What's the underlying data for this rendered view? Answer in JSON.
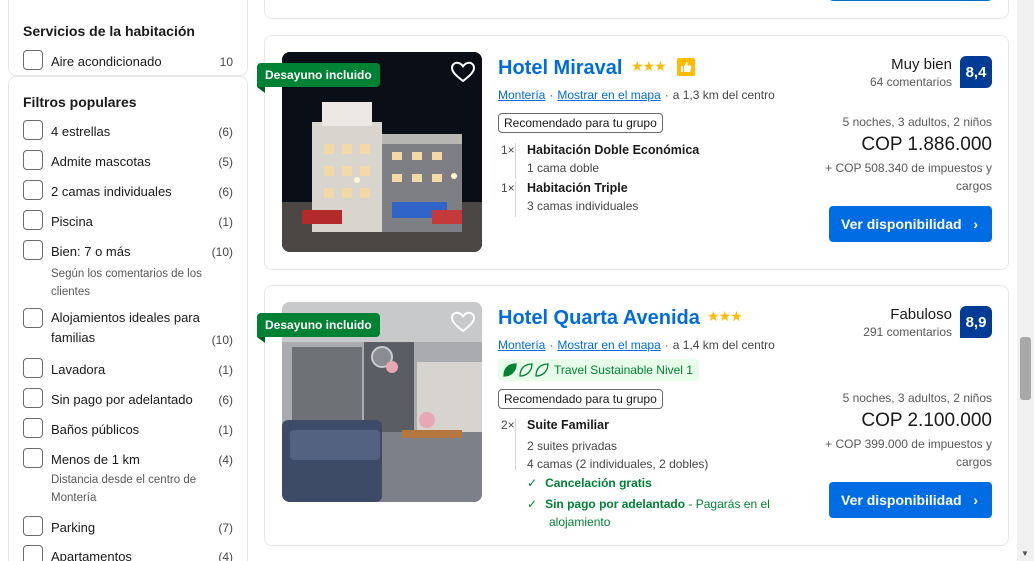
{
  "sidebar": {
    "room_services": {
      "heading": "Servicios de la habitación",
      "items": [
        {
          "label": "Aire acondicionado",
          "count": "10"
        }
      ]
    },
    "popular_filters": {
      "heading": "Filtros populares",
      "items": [
        {
          "label": "4 estrellas",
          "count": "(6)"
        },
        {
          "label": "Admite mascotas",
          "count": "(5)"
        },
        {
          "label": "2 camas individuales",
          "count": "(6)"
        },
        {
          "label": "Piscina",
          "count": "(1)"
        },
        {
          "label": "Bien: 7 o más",
          "count": "(10)",
          "sub": "Según los comentarios de los clientes"
        },
        {
          "label": "Alojamientos ideales para familias",
          "count": "(10)"
        },
        {
          "label": "Lavadora",
          "count": "(1)"
        },
        {
          "label": "Sin pago por adelantado",
          "count": "(6)"
        },
        {
          "label": "Baños públicos",
          "count": "(1)"
        },
        {
          "label": "Menos de 1 km",
          "count": "(4)",
          "sub": "Distancia desde el centro de Montería"
        },
        {
          "label": "Parking",
          "count": "(7)"
        },
        {
          "label": "Apartamentos",
          "count": "(4)"
        }
      ]
    }
  },
  "hotels": [
    {
      "badge": "Desayuno incluido",
      "name": "Hotel Miraval",
      "stars": "★★★",
      "city_link": "Montería",
      "map_link": "Mostrar en el mapa",
      "distance": "a 1,3 km del centro",
      "recommended": "Recomendado para tu grupo",
      "rooms": [
        {
          "qty": "1×",
          "name": "Habitación Doble Económica",
          "detail": "1 cama doble"
        },
        {
          "qty": "1×",
          "name": "Habitación Triple",
          "detail": "3 camas individuales"
        }
      ],
      "rating_word": "Muy bien",
      "reviews": "64 comentarios",
      "score": "8,4",
      "stay": "5 noches, 3 adultos, 2 niños",
      "price": "COP 1.886.000",
      "taxes": "+ COP 508.340 de impuestos y cargos",
      "cta": "Ver disponibilidad"
    },
    {
      "badge": "Desayuno incluido",
      "name": "Hotel Quarta Avenida",
      "stars": "★★★",
      "city_link": "Montería",
      "map_link": "Mostrar en el mapa",
      "distance": "a 1,4 km del centro",
      "sustainable": "Travel Sustainable Nivel 1",
      "recommended": "Recomendado para tu grupo",
      "room": {
        "qty": "2×",
        "name": "Suite Familiar",
        "detail1": "2 suites privadas",
        "detail2": "4 camas (2 individuales, 2 dobles)"
      },
      "free_cancel": "Cancelación gratis",
      "no_prepay": "Sin pago por adelantado",
      "no_prepay_note": " - Pagarás en el",
      "no_prepay_note2": "alojamiento",
      "rating_word": "Fabuloso",
      "reviews": "291 comentarios",
      "score": "8,9",
      "stay": "5 noches, 3 adultos, 2 niños",
      "price": "COP 2.100.000",
      "taxes": "+ COP 399.000 de impuestos y cargos",
      "cta": "Ver disponibilidad"
    }
  ],
  "colors": {
    "link": "#006ce4",
    "score_bg": "#003b95",
    "badge_green": "#008234",
    "star": "#febb02"
  }
}
